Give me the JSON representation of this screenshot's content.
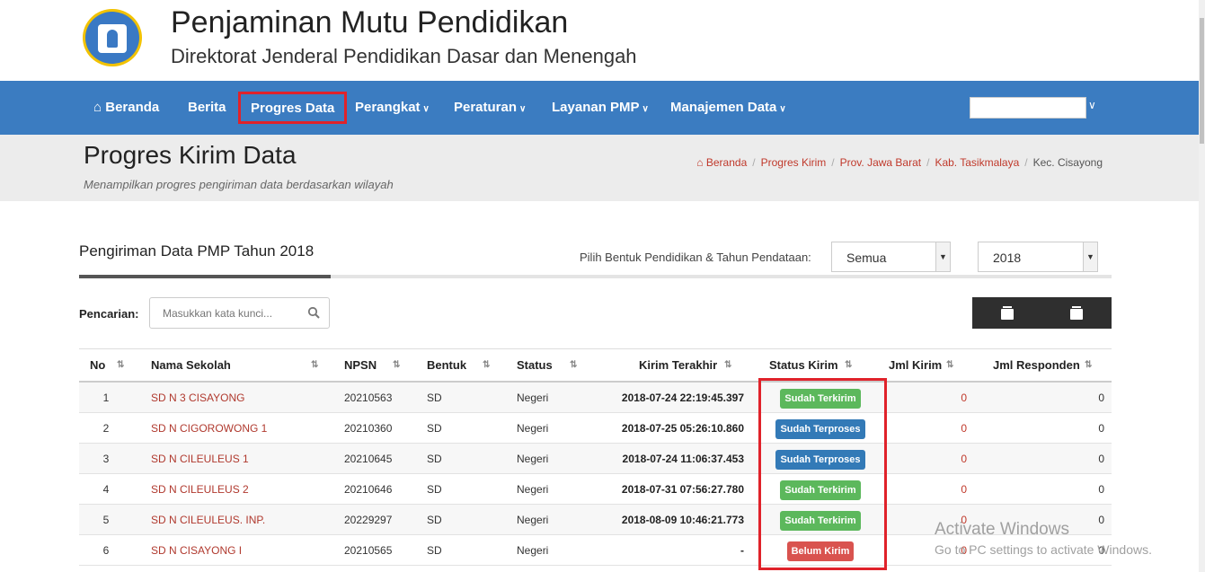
{
  "header": {
    "title": "Penjaminan Mutu Pendidikan",
    "subtitle": "Direktorat Jenderal Pendidikan Dasar dan Menengah"
  },
  "nav": {
    "home": "Beranda",
    "berita": "Berita",
    "progres": "Progres Data",
    "perangkat": "Perangkat",
    "peraturan": "Peraturan",
    "layanan": "Layanan PMP",
    "manajemen": "Manajemen Data"
  },
  "page": {
    "title": "Progres Kirim Data",
    "description": "Menampilkan progres pengiriman data berdasarkan wilayah"
  },
  "breadcrumb": [
    "Beranda",
    "Progres Kirim",
    "Prov. Jawa Barat",
    "Kab. Tasikmalaya",
    "Kec. Cisayong"
  ],
  "section": {
    "title": "Pengiriman Data PMP Tahun 2018",
    "filter_label": "Pilih Bentuk Pendidikan & Tahun Pendataan:",
    "bentuk_value": "Semua",
    "tahun_value": "2018"
  },
  "search": {
    "label": "Pencarian:",
    "placeholder": "Masukkan kata kunci..."
  },
  "table": {
    "headers": [
      "No",
      "Nama Sekolah",
      "NPSN",
      "Bentuk",
      "Status",
      "Kirim Terakhir",
      "Status Kirim",
      "Jml Kirim",
      "Jml Responden"
    ],
    "rows": [
      {
        "no": "1",
        "nama": "SD N 3 CISAYONG",
        "npsn": "20210563",
        "bentuk": "SD",
        "status": "Negeri",
        "kirim": "2018-07-24 22:19:45.397",
        "status_kirim": "Sudah Terkirim",
        "badge": "green",
        "jml_kirim": "0",
        "jml_resp": "0"
      },
      {
        "no": "2",
        "nama": "SD N CIGOROWONG 1",
        "npsn": "20210360",
        "bentuk": "SD",
        "status": "Negeri",
        "kirim": "2018-07-25 05:26:10.860",
        "status_kirim": "Sudah Terproses",
        "badge": "blue",
        "jml_kirim": "0",
        "jml_resp": "0"
      },
      {
        "no": "3",
        "nama": "SD N CILEULEUS 1",
        "npsn": "20210645",
        "bentuk": "SD",
        "status": "Negeri",
        "kirim": "2018-07-24 11:06:37.453",
        "status_kirim": "Sudah Terproses",
        "badge": "blue",
        "jml_kirim": "0",
        "jml_resp": "0"
      },
      {
        "no": "4",
        "nama": "SD N CILEULEUS 2",
        "npsn": "20210646",
        "bentuk": "SD",
        "status": "Negeri",
        "kirim": "2018-07-31 07:56:27.780",
        "status_kirim": "Sudah Terkirim",
        "badge": "green",
        "jml_kirim": "0",
        "jml_resp": "0"
      },
      {
        "no": "5",
        "nama": "SD N CILEULEUS. INP.",
        "npsn": "20229297",
        "bentuk": "SD",
        "status": "Negeri",
        "kirim": "2018-08-09 10:46:21.773",
        "status_kirim": "Sudah Terkirim",
        "badge": "green",
        "jml_kirim": "0",
        "jml_resp": "0"
      },
      {
        "no": "6",
        "nama": "SD N CISAYONG I",
        "npsn": "20210565",
        "bentuk": "SD",
        "status": "Negeri",
        "kirim": "-",
        "status_kirim": "Belum Kirim",
        "badge": "red",
        "jml_kirim": "0",
        "jml_resp": "0"
      }
    ]
  },
  "watermark": {
    "title": "Activate Windows",
    "subtitle": "Go to PC settings to activate Windows."
  },
  "colors": {
    "nav": "#3b7cc1",
    "highlight": "#e0222a",
    "link": "#b0392e",
    "badge_green": "#5cb85c",
    "badge_blue": "#337ab7",
    "badge_red": "#d9534f"
  }
}
